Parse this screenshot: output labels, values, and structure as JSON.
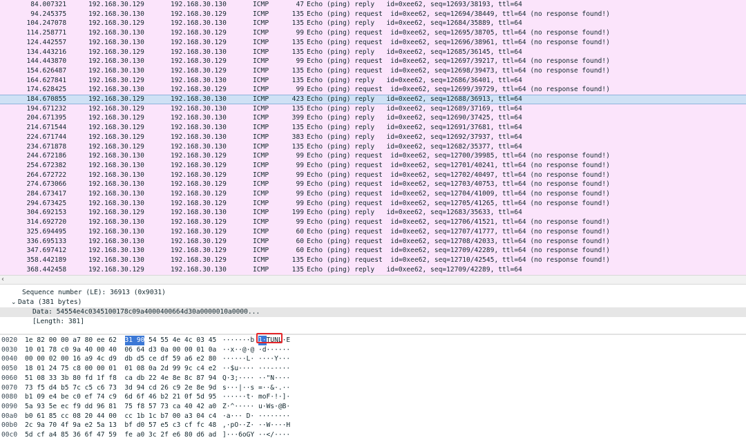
{
  "packets": [
    {
      "no": "8",
      "time": "4.007321",
      "src": "192.168.30.129",
      "dst": "192.168.30.130",
      "proto": "ICMP",
      "len": "47",
      "info": "Echo (ping) reply   id=0xee62, seq=12693/38193, ttl=64"
    },
    {
      "no": "9",
      "time": "4.245375",
      "src": "192.168.30.130",
      "dst": "192.168.30.129",
      "proto": "ICMP",
      "len": "135",
      "info": "Echo (ping) request  id=0xee62, seq=12694/38449, ttl=64 (no response found!)"
    },
    {
      "no": "10",
      "time": "4.247078",
      "src": "192.168.30.129",
      "dst": "192.168.30.130",
      "proto": "ICMP",
      "len": "135",
      "info": "Echo (ping) reply   id=0xee62, seq=12684/35889, ttl=64"
    },
    {
      "no": "11",
      "time": "4.258771",
      "src": "192.168.30.130",
      "dst": "192.168.30.129",
      "proto": "ICMP",
      "len": "99",
      "info": "Echo (ping) request  id=0xee62, seq=12695/38705, ttl=64 (no response found!)"
    },
    {
      "no": "12",
      "time": "4.442557",
      "src": "192.168.30.130",
      "dst": "192.168.30.129",
      "proto": "ICMP",
      "len": "135",
      "info": "Echo (ping) request  id=0xee62, seq=12696/38961, ttl=64 (no response found!)"
    },
    {
      "no": "13",
      "time": "4.443216",
      "src": "192.168.30.129",
      "dst": "192.168.30.130",
      "proto": "ICMP",
      "len": "135",
      "info": "Echo (ping) reply   id=0xee62, seq=12685/36145, ttl=64"
    },
    {
      "no": "14",
      "time": "4.443870",
      "src": "192.168.30.130",
      "dst": "192.168.30.129",
      "proto": "ICMP",
      "len": "99",
      "info": "Echo (ping) request  id=0xee62, seq=12697/39217, ttl=64 (no response found!)"
    },
    {
      "no": "15",
      "time": "4.626487",
      "src": "192.168.30.130",
      "dst": "192.168.30.129",
      "proto": "ICMP",
      "len": "135",
      "info": "Echo (ping) request  id=0xee62, seq=12698/39473, ttl=64 (no response found!)"
    },
    {
      "no": "16",
      "time": "4.627841",
      "src": "192.168.30.129",
      "dst": "192.168.30.130",
      "proto": "ICMP",
      "len": "135",
      "info": "Echo (ping) reply   id=0xee62, seq=12686/36401, ttl=64"
    },
    {
      "no": "17",
      "time": "4.628425",
      "src": "192.168.30.130",
      "dst": "192.168.30.129",
      "proto": "ICMP",
      "len": "99",
      "info": "Echo (ping) request  id=0xee62, seq=12699/39729, ttl=64 (no response found!)"
    },
    {
      "no": "18",
      "time": "4.670855",
      "src": "192.168.30.129",
      "dst": "192.168.30.130",
      "proto": "ICMP",
      "len": "423",
      "info": "Echo (ping) reply   id=0xee62, seq=12688/36913, ttl=64"
    },
    {
      "no": "19",
      "time": "4.671232",
      "src": "192.168.30.129",
      "dst": "192.168.30.130",
      "proto": "ICMP",
      "len": "135",
      "info": "Echo (ping) reply   id=0xee62, seq=12689/37169, ttl=64"
    },
    {
      "no": "20",
      "time": "4.671395",
      "src": "192.168.30.129",
      "dst": "192.168.30.130",
      "proto": "ICMP",
      "len": "399",
      "info": "Echo (ping) reply   id=0xee62, seq=12690/37425, ttl=64"
    },
    {
      "no": "21",
      "time": "4.671544",
      "src": "192.168.30.129",
      "dst": "192.168.30.130",
      "proto": "ICMP",
      "len": "135",
      "info": "Echo (ping) reply   id=0xee62, seq=12691/37681, ttl=64"
    },
    {
      "no": "22",
      "time": "4.671744",
      "src": "192.168.30.129",
      "dst": "192.168.30.130",
      "proto": "ICMP",
      "len": "383",
      "info": "Echo (ping) reply   id=0xee62, seq=12692/37937, ttl=64"
    },
    {
      "no": "23",
      "time": "4.671878",
      "src": "192.168.30.129",
      "dst": "192.168.30.130",
      "proto": "ICMP",
      "len": "135",
      "info": "Echo (ping) reply   id=0xee62, seq=12682/35377, ttl=64"
    },
    {
      "no": "24",
      "time": "4.672186",
      "src": "192.168.30.130",
      "dst": "192.168.30.129",
      "proto": "ICMP",
      "len": "99",
      "info": "Echo (ping) request  id=0xee62, seq=12700/39985, ttl=64 (no response found!)"
    },
    {
      "no": "25",
      "time": "4.672382",
      "src": "192.168.30.130",
      "dst": "192.168.30.129",
      "proto": "ICMP",
      "len": "99",
      "info": "Echo (ping) request  id=0xee62, seq=12701/40241, ttl=64 (no response found!)"
    },
    {
      "no": "26",
      "time": "4.672722",
      "src": "192.168.30.130",
      "dst": "192.168.30.129",
      "proto": "ICMP",
      "len": "99",
      "info": "Echo (ping) request  id=0xee62, seq=12702/40497, ttl=64 (no response found!)"
    },
    {
      "no": "27",
      "time": "4.673066",
      "src": "192.168.30.130",
      "dst": "192.168.30.129",
      "proto": "ICMP",
      "len": "99",
      "info": "Echo (ping) request  id=0xee62, seq=12703/40753, ttl=64 (no response found!)"
    },
    {
      "no": "28",
      "time": "4.673417",
      "src": "192.168.30.130",
      "dst": "192.168.30.129",
      "proto": "ICMP",
      "len": "99",
      "info": "Echo (ping) request  id=0xee62, seq=12704/41009, ttl=64 (no response found!)"
    },
    {
      "no": "29",
      "time": "4.673425",
      "src": "192.168.30.130",
      "dst": "192.168.30.129",
      "proto": "ICMP",
      "len": "99",
      "info": "Echo (ping) request  id=0xee62, seq=12705/41265, ttl=64 (no response found!)"
    },
    {
      "no": "30",
      "time": "4.692153",
      "src": "192.168.30.129",
      "dst": "192.168.30.130",
      "proto": "ICMP",
      "len": "199",
      "info": "Echo (ping) reply   id=0xee62, seq=12683/35633, ttl=64"
    },
    {
      "no": "31",
      "time": "4.692720",
      "src": "192.168.30.130",
      "dst": "192.168.30.129",
      "proto": "ICMP",
      "len": "99",
      "info": "Echo (ping) request  id=0xee62, seq=12706/41521, ttl=64 (no response found!)"
    },
    {
      "no": "32",
      "time": "5.694495",
      "src": "192.168.30.130",
      "dst": "192.168.30.129",
      "proto": "ICMP",
      "len": "60",
      "info": "Echo (ping) request  id=0xee62, seq=12707/41777, ttl=64 (no response found!)"
    },
    {
      "no": "33",
      "time": "6.695133",
      "src": "192.168.30.130",
      "dst": "192.168.30.129",
      "proto": "ICMP",
      "len": "60",
      "info": "Echo (ping) request  id=0xee62, seq=12708/42033, ttl=64 (no response found!)"
    },
    {
      "no": "34",
      "time": "7.697412",
      "src": "192.168.30.130",
      "dst": "192.168.30.129",
      "proto": "ICMP",
      "len": "60",
      "info": "Echo (ping) request  id=0xee62, seq=12709/42289, ttl=64 (no response found!)"
    },
    {
      "no": "35",
      "time": "8.442189",
      "src": "192.168.30.130",
      "dst": "192.168.30.129",
      "proto": "ICMP",
      "len": "135",
      "info": "Echo (ping) request  id=0xee62, seq=12710/42545, ttl=64 (no response found!)"
    },
    {
      "no": "36",
      "time": "8.442458",
      "src": "192.168.30.129",
      "dst": "192.168.30.130",
      "proto": "ICMP",
      "len": "135",
      "info": "Echo (ping) reply   id=0xee62, seq=12709/42289, ttl=64"
    }
  ],
  "selected_packet": "18",
  "details": {
    "seq_le": "Sequence number (LE): 36913 (0x9031)",
    "data_header": "Data (381 bytes)",
    "data_value": "Data: 54554e4c0345100178c09a4000400664d30a0000010a0000...",
    "data_length": "[Length: 381]"
  },
  "bytes": [
    {
      "off": "0020",
      "hex": "1e 82 00 00 a7 80 ee 62  31 90 54 55 4e 4c 03 45",
      "ascii": "·······b 1·TUNL·E"
    },
    {
      "off": "0030",
      "hex": "10 01 78 c0 9a 40 00 40  06 64 d3 0a 00 00 01 0a",
      "ascii": "··x··@·@ ·d······"
    },
    {
      "off": "0040",
      "hex": "00 00 02 00 16 a9 4c d9  db d5 ce df 59 a6 e2 80",
      "ascii": "······L· ····Y···"
    },
    {
      "off": "0050",
      "hex": "18 01 24 75 c8 00 00 01  01 08 0a 2d 99 9c c4 e2",
      "ascii": "··$u···· ···-····"
    },
    {
      "off": "0060",
      "hex": "51 08 33 3b 80 fd 1f f8  ca db 22 4e 8e 8c 87 94",
      "ascii": "Q·3;···· ··\"N····"
    },
    {
      "off": "0070",
      "hex": "73 f5 d4 b5 7c c5 c6 73  3d 94 cd 26 c9 2e 8e 9d",
      "ascii": "s···|··s =··&·.··"
    },
    {
      "off": "0080",
      "hex": "b1 09 e4 be c0 ef 74 c9  6d 6f 46 b2 21 0f 5d 95",
      "ascii": "······t· moF·!·]·"
    },
    {
      "off": "0090",
      "hex": "5a 93 5e ec f9 dd 96 81  75 f8 57 73 ca 40 42 a0",
      "ascii": "Z·^····· u·Ws·@B·"
    },
    {
      "off": "00a0",
      "hex": "b0 61 85 cc 08 20 44 00  cc 1b 1c b7 00 a3 04 c4",
      "ascii": "·a··· D· ········"
    },
    {
      "off": "00b0",
      "hex": "2c 9a 70 4f 9a e2 5a 13  bf d0 57 e5 c3 cf fc 48",
      "ascii": ",·pO··Z· ··W····H"
    },
    {
      "off": "00c0",
      "hex": "5d cf a4 85 36 6f 47 59  fe a0 3c 2f e6 80 d6 ad",
      "ascii": "]···6oGY ··</····"
    }
  ],
  "selection": {
    "hex_bytes": "31 90",
    "ascii_bytes": "1·"
  },
  "colors": {
    "row_bg": "#fbe4fb",
    "selected_row": "#cfe1f5",
    "byte_highlight": "#3b78d6",
    "annotation_box": "#e4262a"
  },
  "icons": {
    "scroll_left": "scroll-left-arrow-icon",
    "tree_expanded": "tree-expanded-icon"
  }
}
